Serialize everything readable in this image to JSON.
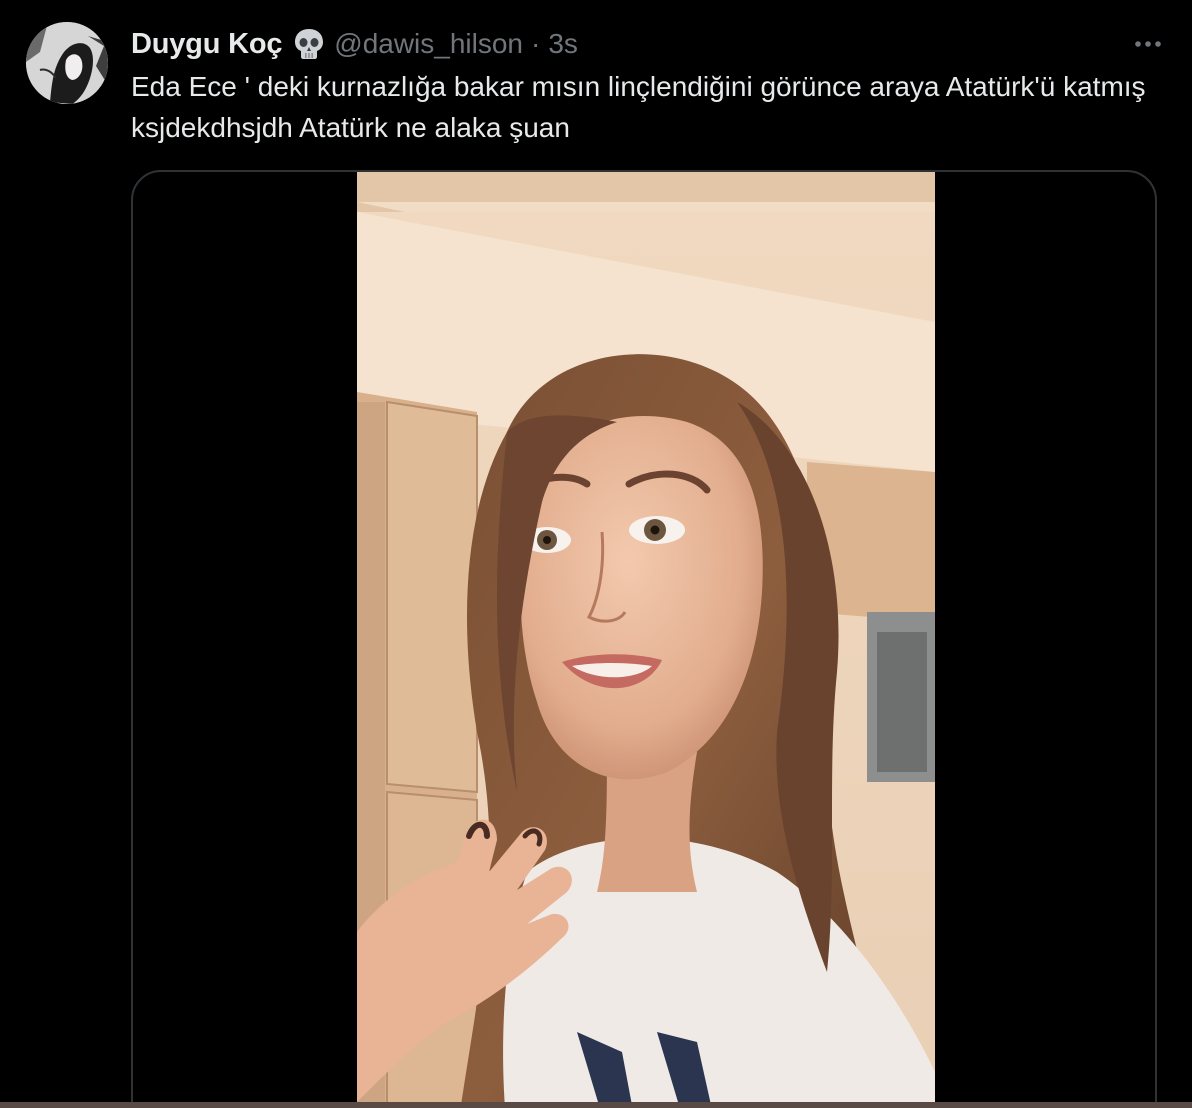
{
  "tweet": {
    "author": {
      "display_name": "Duygu Koç",
      "name_emoji": "skull-icon",
      "handle": "@dawis_hilson"
    },
    "separator": "·",
    "timestamp": "3s",
    "more_icon": "more-horizontal-icon",
    "text": "Eda Ece ' deki kurnazlığa bakar mısın linçlendiğini görünce araya Atatürk'ü katmış ksjdekdhsjdh Atatürk ne alaka şuan",
    "media": {
      "type": "video"
    }
  },
  "colors": {
    "background": "#000000",
    "primary_text": "#e7e9ea",
    "secondary_text": "#71767b",
    "border": "#2f3336"
  }
}
